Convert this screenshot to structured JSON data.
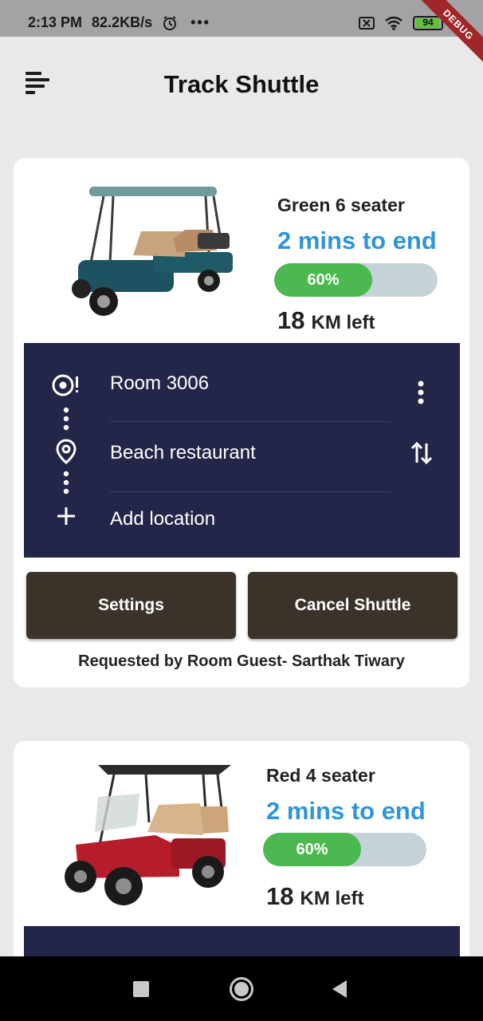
{
  "status_bar": {
    "time": "2:13 PM",
    "speed": "82.2KB/s",
    "more": "•••",
    "battery_level": "94",
    "battery_fraction": 0.94,
    "debug_label": "DEBUG",
    "icons": [
      "alarm-icon",
      "sim-off-icon",
      "wifi-icon",
      "battery-icon"
    ]
  },
  "app_bar": {
    "title": "Track Shuttle",
    "menu_icon": "menu-icon"
  },
  "shuttles": [
    {
      "name": "Green 6 seater",
      "eta": "2 mins to end",
      "progress_label": "60%",
      "progress": 0.6,
      "km_value": "18",
      "km_unit": "KM left",
      "route": {
        "stops": [
          "Room 3006",
          "Beach restaurant"
        ],
        "add_label": "Add location",
        "icons": [
          "origin-icon",
          "destination-pin-icon",
          "add-icon",
          "more-vert-icon",
          "swap-icon"
        ]
      },
      "buttons": {
        "settings": "Settings",
        "cancel": "Cancel Shuttle"
      },
      "requested_by": "Requested by Room Guest- Sarthak Tiwary"
    },
    {
      "name": "Red 4 seater",
      "eta": "2 mins to end",
      "progress_label": "60%",
      "progress": 0.6,
      "km_value": "18",
      "km_unit": "KM left"
    }
  ],
  "colors": {
    "accent_blue": "#2f95da",
    "progress_green": "#4bb94f",
    "route_panel": "#232648",
    "button_bg": "#3b332a"
  },
  "nav_bar": {
    "icons": [
      "recents-square-icon",
      "home-circle-icon",
      "back-triangle-icon"
    ]
  }
}
